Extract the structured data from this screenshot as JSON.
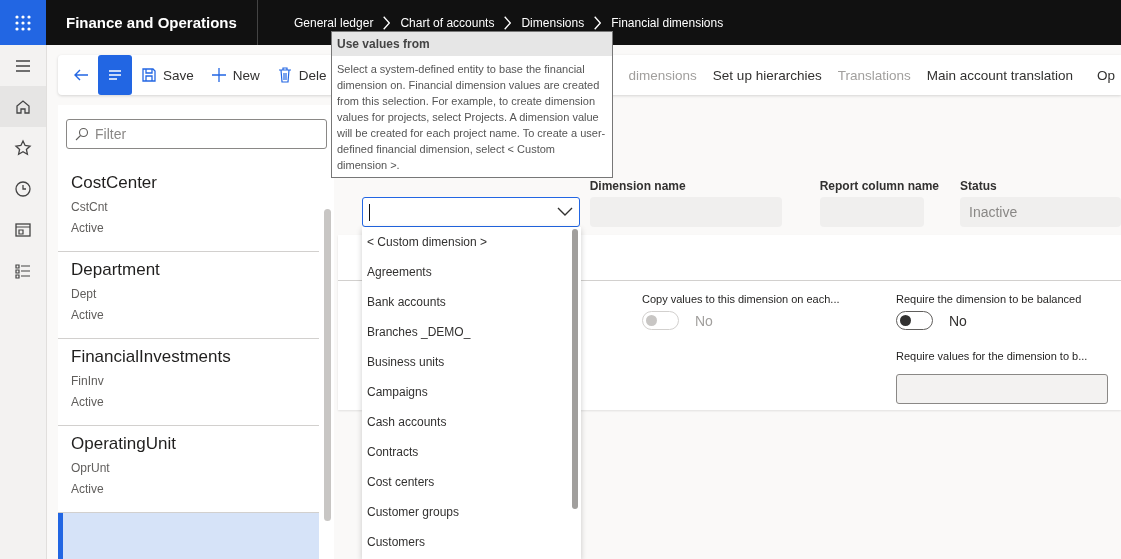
{
  "app": {
    "title": "Finance and Operations"
  },
  "breadcrumb": [
    "General ledger",
    "Chart of accounts",
    "Dimensions",
    "Financial dimensions"
  ],
  "nav": [
    {
      "kind": "menu",
      "selected": false
    },
    {
      "kind": "home",
      "selected": true
    },
    {
      "kind": "star",
      "selected": false
    },
    {
      "kind": "clock",
      "selected": false
    },
    {
      "kind": "workspace",
      "selected": false
    },
    {
      "kind": "list",
      "selected": false
    }
  ],
  "toolbar": {
    "actions": [
      {
        "kind": "back",
        "selected": false
      },
      {
        "kind": "lines",
        "selected": true
      },
      {
        "kind": "save",
        "label": "Save",
        "selected": false
      },
      {
        "kind": "new",
        "label": "New",
        "selected": false
      },
      {
        "kind": "delete",
        "label": "Dele",
        "selected": false
      }
    ],
    "menu": [
      {
        "label": "dimensions",
        "disabled": true
      },
      {
        "label": "Set up hierarchies",
        "disabled": false
      },
      {
        "label": "Translations",
        "disabled": true
      },
      {
        "label": "Main account translation",
        "disabled": false
      }
    ],
    "overflow": "Op"
  },
  "list": {
    "filter": {
      "placeholder": "Filter"
    },
    "items": [
      {
        "name": "CostCenter",
        "code": "CstCnt",
        "status": "Active",
        "selected": false
      },
      {
        "name": "Department",
        "code": "Dept",
        "status": "Active",
        "selected": false
      },
      {
        "name": "FinancialInvestments",
        "code": "FinInv",
        "status": "Active",
        "selected": false
      },
      {
        "name": "OperatingUnit",
        "code": "OprUnt",
        "status": "Active",
        "selected": false
      },
      {
        "selected": true
      }
    ]
  },
  "form": {
    "fields": [
      {
        "label": "Dimension name"
      },
      {
        "label": "Report column name"
      },
      {
        "label": "Status",
        "value": "Inactive"
      }
    ],
    "use_values_from": {
      "options": [
        "< Custom dimension >",
        "Agreements",
        "Bank accounts",
        "Branches _DEMO_",
        "Business units",
        "Campaigns",
        "Cash accounts",
        "Contracts",
        "Cost centers",
        "Customer groups",
        "Customers"
      ]
    },
    "toggles": [
      {
        "label": "Copy values to this dimension on each...",
        "on": false,
        "disabled": true,
        "value": "No"
      },
      {
        "label": "Require the dimension to be balanced",
        "on": false,
        "disabled": false,
        "value": "No"
      }
    ],
    "require_values": {
      "label": "Require values for the dimension to b..."
    }
  },
  "tooltip": {
    "title": "Use values from",
    "text": "Select a system-defined entity to base the financial dimension on. Financial dimension values are created from this selection. For example, to create dimension values for projects, select Projects. A dimension value will be created for each project name. To create a user-defined financial dimension, select < Custom dimension >."
  }
}
